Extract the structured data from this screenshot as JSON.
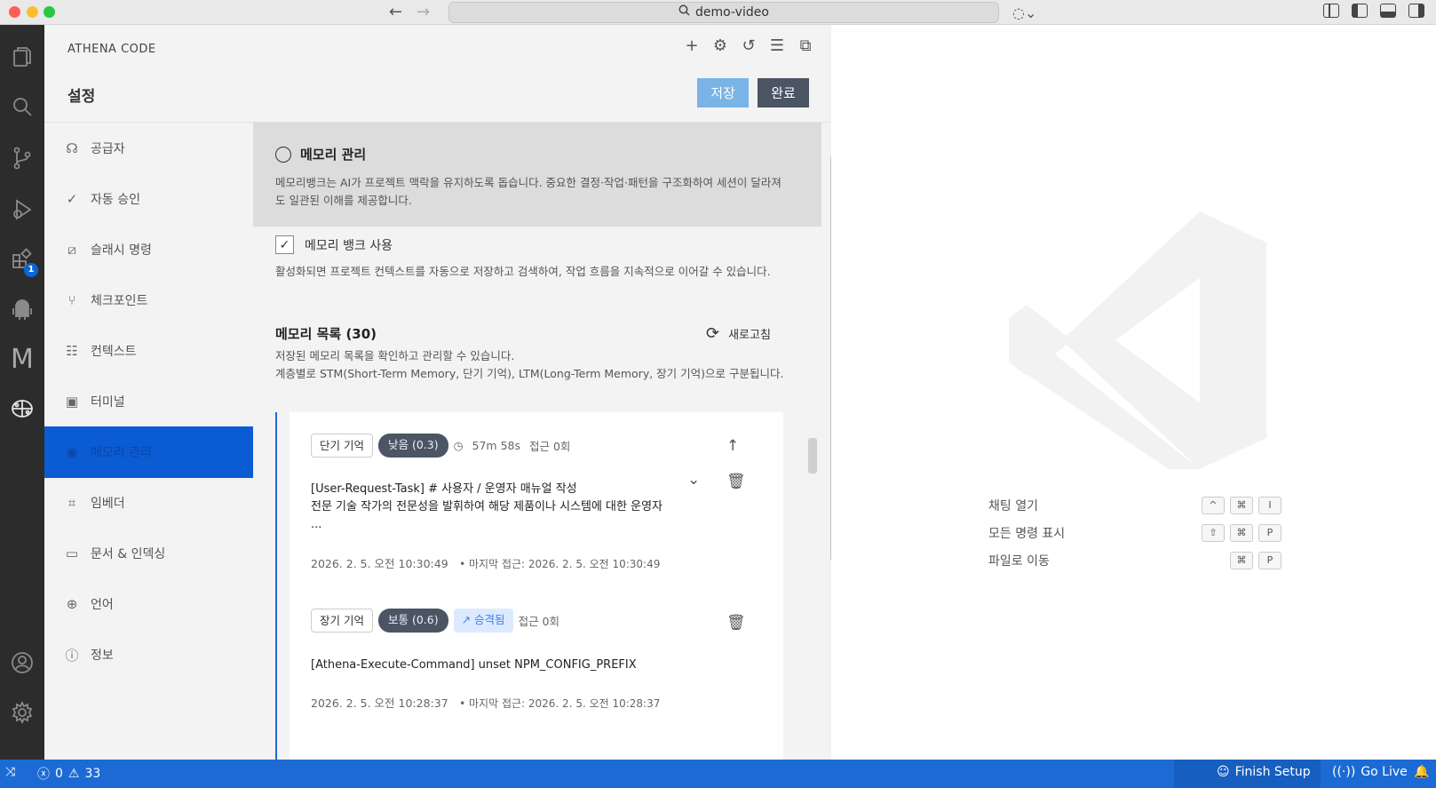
{
  "titlebar": {
    "search_text": "demo-video"
  },
  "activity": {
    "extensions_badge": "1"
  },
  "panel": {
    "app_name": "ATHENA CODE",
    "title": "설정",
    "save_label": "저장",
    "done_label": "완료"
  },
  "nav": {
    "items": [
      {
        "label": "공급자",
        "icon": "webhook-icon"
      },
      {
        "label": "자동 승인",
        "icon": "check-all-icon"
      },
      {
        "label": "슬래시 명령",
        "icon": "slash-icon"
      },
      {
        "label": "체크포인트",
        "icon": "git-branch-icon"
      },
      {
        "label": "컨텍스트",
        "icon": "database-icon"
      },
      {
        "label": "터미널",
        "icon": "terminal-icon"
      },
      {
        "label": "메모리 관리",
        "icon": "brain-icon"
      },
      {
        "label": "임베더",
        "icon": "cpu-icon"
      },
      {
        "label": "문서 & 인덱싱",
        "icon": "book-icon"
      },
      {
        "label": "언어",
        "icon": "globe-icon"
      },
      {
        "label": "정보",
        "icon": "info-icon"
      }
    ]
  },
  "memory": {
    "section_title": "메모리 관리",
    "section_desc": "메모리뱅크는 AI가 프로젝트 맥락을 유지하도록 돕습니다. 중요한 결정·작업·패턴을 구조화하여 세션이 달라져도 일관된 이해를 제공합니다.",
    "enable_label": "메모리 뱅크 사용",
    "enable_desc": "활성화되면 프로젝트 컨텍스트를 자동으로 저장하고 검색하여, 작업 흐름을 지속적으로 이어갈 수 있습니다.",
    "list_title": "메모리 목록 (30)",
    "refresh_label": "새로고침",
    "list_desc_1": "저장된 메모리 목록을 확인하고 관리할 수 있습니다.",
    "list_desc_2": "계층별로 STM(Short-Term Memory, 단기 기억), LTM(Long-Term Memory, 장기 기억)으로 구분됩니다.",
    "cards": [
      {
        "type": "단기 기억",
        "priority": "낮음 (0.3)",
        "age": "57m 58s",
        "access": "접근 0회",
        "title_line1": "[User-Request-Task] # 사용자 / 운영자 매뉴얼 작성",
        "title_line2": "전문 기술 작가의 전문성을 발휘하여 해당 제품이나 시스템에 대한 운영자",
        "title_line3": "...",
        "created": "2026. 2. 5. 오전 10:30:49",
        "last_access": "• 마지막 접근: 2026. 2. 5. 오전 10:30:49"
      },
      {
        "type": "장기 기억",
        "priority": "보통 (0.6)",
        "promoted": "승격됨",
        "access": "접근 0회",
        "title_line1": "[Athena-Execute-Command] unset NPM_CONFIG_PREFIX",
        "created": "2026. 2. 5. 오전 10:28:37",
        "last_access": "• 마지막 접근: 2026. 2. 5. 오전 10:28:37"
      }
    ]
  },
  "editor": {
    "shortcuts": [
      {
        "label": "채팅 열기",
        "keys": [
          "^",
          "⌘",
          "I"
        ]
      },
      {
        "label": "모든 명령 표시",
        "keys": [
          "⇧",
          "⌘",
          "P"
        ]
      },
      {
        "label": "파일로 이동",
        "keys": [
          "⌘",
          "P"
        ]
      }
    ]
  },
  "statusbar": {
    "errors": "0",
    "warnings": "33",
    "finish_setup": "Finish Setup",
    "go_live": "Go Live",
    "accent_color": "#1c6bd5"
  }
}
